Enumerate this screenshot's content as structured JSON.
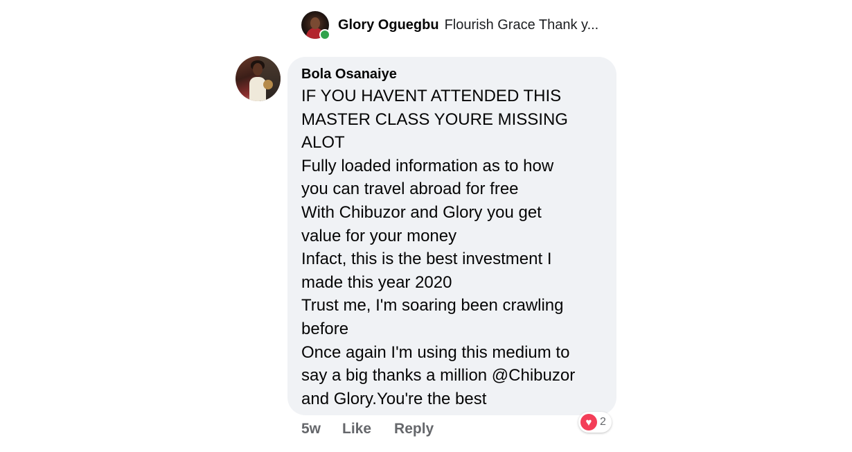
{
  "reply_preview": {
    "author": "Glory Oguegbu",
    "text": "Flourish Grace Thank y...",
    "avatar_icon": "profile-photo",
    "online_color": "#31a24c"
  },
  "comment": {
    "author": "Bola Osanaiye",
    "lines": [
      "IF YOU HAVENT ATTENDED THIS",
      "MASTER CLASS YOURE MISSING",
      "ALOT",
      "Fully loaded information as to how",
      "you can travel abroad for free",
      "With Chibuzor and Glory you get",
      "value for your money",
      "Infact, this is the best investment I",
      "made this year 2020",
      "Trust me, I'm soaring been crawling",
      "before",
      "Once again I'm using this medium to",
      "say a big thanks a million @Chibuzor",
      "and Glory.You're the best"
    ],
    "bubble_color": "#f0f2f5"
  },
  "actions": {
    "time": "5w",
    "like": "Like",
    "reply": "Reply"
  },
  "reaction": {
    "icon": "heart-icon",
    "count": "2",
    "color": "#f33e58"
  }
}
